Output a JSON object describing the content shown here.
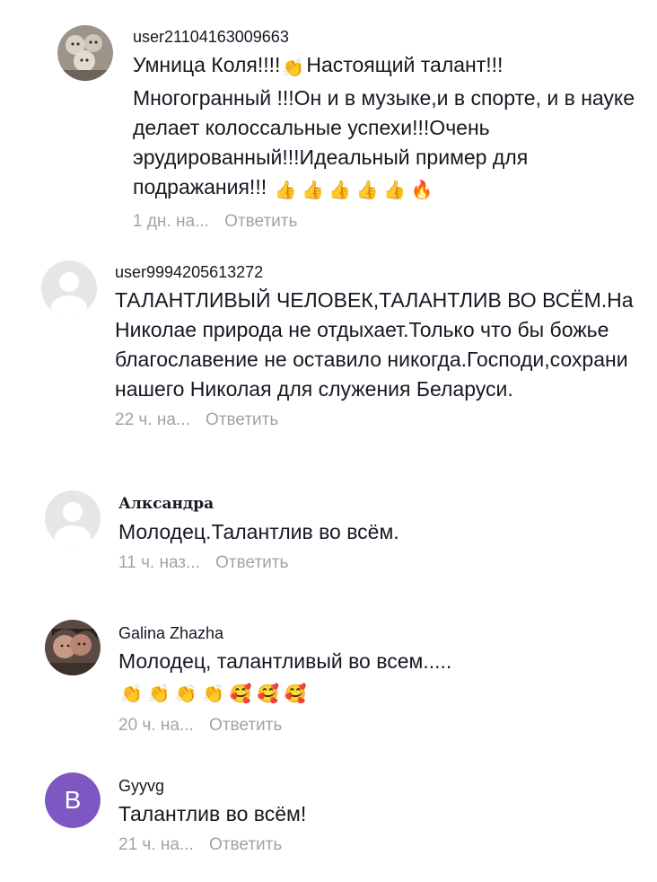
{
  "comments": [
    {
      "username": "user21104163009663",
      "text_parts": [
        "Умница Коля!!!!",
        "Настоящий талант!!! Многогранный !!!Он и в музыке,и в спорте, и в науке делает колоссальные успехи!!!Очень эрудированный!!!Идеальный пример для подражания!!!"
      ],
      "emojis_inline": "👏",
      "emojis_tail": "👍 👍 👍 👍 👍 🔥",
      "time": "1 дн. на...",
      "reply": "Ответить",
      "avatar_icon": "photo-avatar"
    },
    {
      "username": "user9994205613272",
      "text": "ТАЛАНТЛИВЫЙ ЧЕЛОВЕК,ТАЛАНТЛИВ ВО ВСЁМ.На Николае природа не отдыхает.Только что бы божье благославение не оставило никогда.Господи,сохрани нашего Николая для служения Беларуси.",
      "time": "22 ч. на...",
      "reply": "Ответить",
      "avatar_icon": "default-avatar"
    },
    {
      "username": "Алксандра",
      "text": "Молодец.Талантлив во всём.",
      "time": "11 ч. наз...",
      "reply": "Ответить",
      "avatar_icon": "default-avatar"
    },
    {
      "username": "Galina Zhazha",
      "text": "Молодец, талантливый во всем.....",
      "emojis_tail": "👏 👏 👏 👏 🥰 🥰 🥰",
      "time": "20 ч. на...",
      "reply": "Ответить",
      "avatar_icon": "photo-avatar"
    },
    {
      "username": "Gyyvg",
      "avatar_letter": "B",
      "text": "Талантлив во всём!",
      "time": "21 ч. на...",
      "reply": "Ответить",
      "avatar_color": "#7e57c2"
    }
  ]
}
